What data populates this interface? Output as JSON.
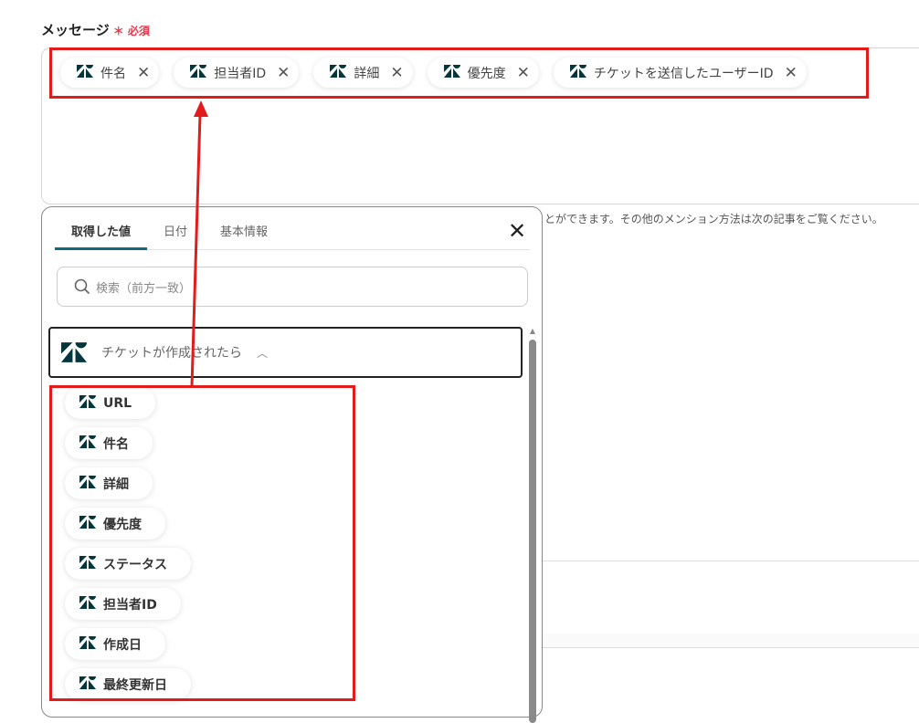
{
  "field": {
    "label": "メッセージ",
    "required_mark": "＊",
    "required_text": "必須"
  },
  "tags": [
    {
      "label": "件名"
    },
    {
      "label": "担当者ID"
    },
    {
      "label": "詳細"
    },
    {
      "label": "優先度"
    },
    {
      "label": "チケットを送信したユーザーID"
    }
  ],
  "hint": "とができます。その他のメンション方法は次の記事をご覧ください。",
  "popup": {
    "tabs": [
      "取得した値",
      "日付",
      "基本情報"
    ],
    "search_placeholder": "検索（前方一致）",
    "section_title": "チケットが作成されたら",
    "items": [
      "URL",
      "件名",
      "詳細",
      "優先度",
      "ステータス",
      "担当者ID",
      "作成日",
      "最終更新日"
    ]
  },
  "colors": {
    "accent": "#0f6b7f",
    "annotation": "#e21b1b",
    "required": "#e8374a",
    "logo": "#03363d"
  }
}
